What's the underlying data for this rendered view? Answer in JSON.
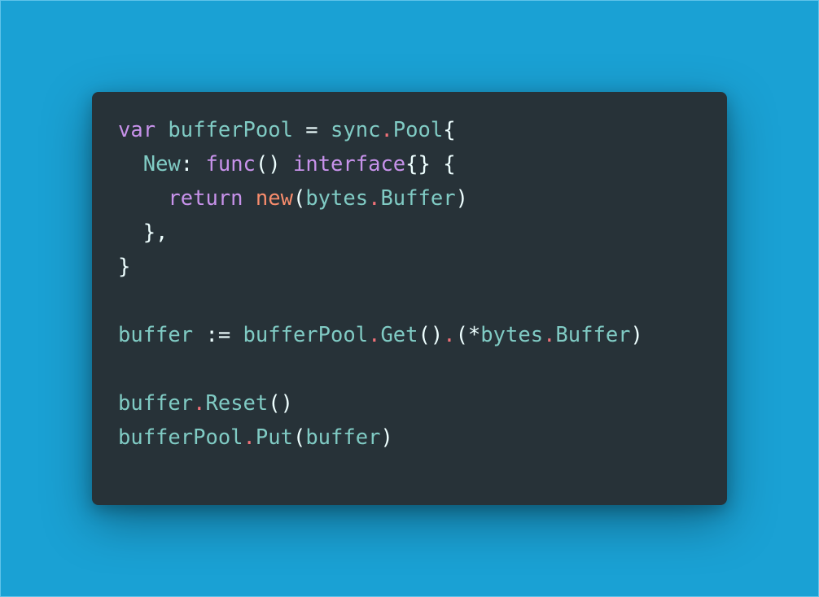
{
  "colors": {
    "background": "#1aa1d4",
    "card": "#273238",
    "keyword": "#c792ea",
    "identifier": "#80cbc4",
    "plain": "#eeffff",
    "operator_dot": "#f07178",
    "builtin": "#f78c6c"
  },
  "code_lines": [
    [
      {
        "t": "var",
        "c": "kw"
      },
      {
        "t": " ",
        "c": "pl"
      },
      {
        "t": "bufferPool",
        "c": "id"
      },
      {
        "t": " = ",
        "c": "pl"
      },
      {
        "t": "sync",
        "c": "id"
      },
      {
        "t": ".",
        "c": "dot"
      },
      {
        "t": "Pool",
        "c": "id"
      },
      {
        "t": "{",
        "c": "pl"
      }
    ],
    [
      {
        "t": "  ",
        "c": "pl"
      },
      {
        "t": "New",
        "c": "id"
      },
      {
        "t": ": ",
        "c": "pl"
      },
      {
        "t": "func",
        "c": "kw"
      },
      {
        "t": "() ",
        "c": "pl"
      },
      {
        "t": "interface",
        "c": "kw"
      },
      {
        "t": "{} {",
        "c": "pl"
      }
    ],
    [
      {
        "t": "    ",
        "c": "pl"
      },
      {
        "t": "return",
        "c": "kw"
      },
      {
        "t": " ",
        "c": "pl"
      },
      {
        "t": "new",
        "c": "nw"
      },
      {
        "t": "(",
        "c": "pl"
      },
      {
        "t": "bytes",
        "c": "id"
      },
      {
        "t": ".",
        "c": "dot"
      },
      {
        "t": "Buffer",
        "c": "id"
      },
      {
        "t": ")",
        "c": "pl"
      }
    ],
    [
      {
        "t": "  },",
        "c": "pl"
      }
    ],
    [
      {
        "t": "}",
        "c": "pl"
      }
    ],
    [],
    [
      {
        "t": "buffer",
        "c": "id"
      },
      {
        "t": " := ",
        "c": "pl"
      },
      {
        "t": "bufferPool",
        "c": "id"
      },
      {
        "t": ".",
        "c": "dot"
      },
      {
        "t": "Get",
        "c": "id"
      },
      {
        "t": "()",
        "c": "pl"
      },
      {
        "t": ".",
        "c": "dot"
      },
      {
        "t": "(*",
        "c": "pl"
      },
      {
        "t": "bytes",
        "c": "id"
      },
      {
        "t": ".",
        "c": "dot"
      },
      {
        "t": "Buffer",
        "c": "id"
      },
      {
        "t": ")",
        "c": "pl"
      }
    ],
    [],
    [
      {
        "t": "buffer",
        "c": "id"
      },
      {
        "t": ".",
        "c": "dot"
      },
      {
        "t": "Reset",
        "c": "id"
      },
      {
        "t": "()",
        "c": "pl"
      }
    ],
    [
      {
        "t": "bufferPool",
        "c": "id"
      },
      {
        "t": ".",
        "c": "dot"
      },
      {
        "t": "Put",
        "c": "id"
      },
      {
        "t": "(",
        "c": "pl"
      },
      {
        "t": "buffer",
        "c": "id"
      },
      {
        "t": ")",
        "c": "pl"
      }
    ]
  ]
}
